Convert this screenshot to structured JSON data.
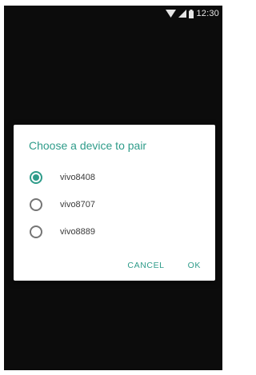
{
  "status_bar": {
    "time": "12:30",
    "icons": [
      "wifi-icon",
      "signal-icon",
      "battery-icon"
    ]
  },
  "dialog": {
    "title": "Choose a device to pair",
    "options": [
      {
        "label": "vivo8408",
        "selected": true
      },
      {
        "label": "vivo8707",
        "selected": false
      },
      {
        "label": "vivo8889",
        "selected": false
      }
    ],
    "cancel_label": "CANCEL",
    "ok_label": "OK"
  },
  "colors": {
    "accent": "#2f9c8a",
    "background": "#0c0c0c",
    "dialog_background": "#ffffff"
  }
}
